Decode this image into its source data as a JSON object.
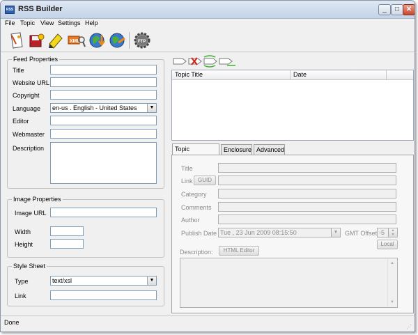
{
  "window": {
    "title": "RSS Builder",
    "icon_label": "RSS"
  },
  "menu": [
    "File",
    "Topic",
    "View",
    "Settings",
    "Help"
  ],
  "toolbar_icons": [
    "new-feed-icon",
    "save-feed-icon",
    "edit-feed-icon",
    "xml-view-icon",
    "publish-ftp-icon",
    "web-globe-icon",
    "ftp-settings-icon"
  ],
  "feed_properties": {
    "title": "Feed Properties",
    "labels": {
      "title": "Title",
      "website": "Website URL",
      "copyright": "Copyright",
      "language": "Language",
      "editor": "Editor",
      "webmaster": "Webmaster",
      "description": "Description"
    },
    "values": {
      "title": "",
      "website": "",
      "copyright": "",
      "language": "en-us . English - United States",
      "editor": "",
      "webmaster": "",
      "description": ""
    }
  },
  "image_properties": {
    "title": "Image Properties",
    "labels": {
      "url": "Image URL",
      "width": "Width",
      "height": "Height"
    },
    "values": {
      "url": "",
      "width": "",
      "height": ""
    }
  },
  "style_sheet": {
    "title": "Style Sheet",
    "labels": {
      "type": "Type",
      "link": "Link"
    },
    "values": {
      "type": "text/xsl",
      "link": ""
    }
  },
  "topic_list": {
    "columns": [
      "Topic Title",
      "Date"
    ]
  },
  "tabs": [
    "Topic Properties",
    "Enclosure",
    "Advanced"
  ],
  "topic_properties": {
    "labels": {
      "title": "Title",
      "link": "Link",
      "guid": "GUID",
      "category": "Category",
      "comments": "Comments",
      "author": "Author",
      "publish_date": "Publish Date",
      "gmt_offset": "GMT Offset",
      "local": "Local",
      "description": "Description:",
      "html_editor": "HTML Editor"
    },
    "values": {
      "publish_date": "Tue , 23 Jun 2009 08:15:50",
      "gmt_offset": "-5"
    }
  },
  "status": "Done"
}
